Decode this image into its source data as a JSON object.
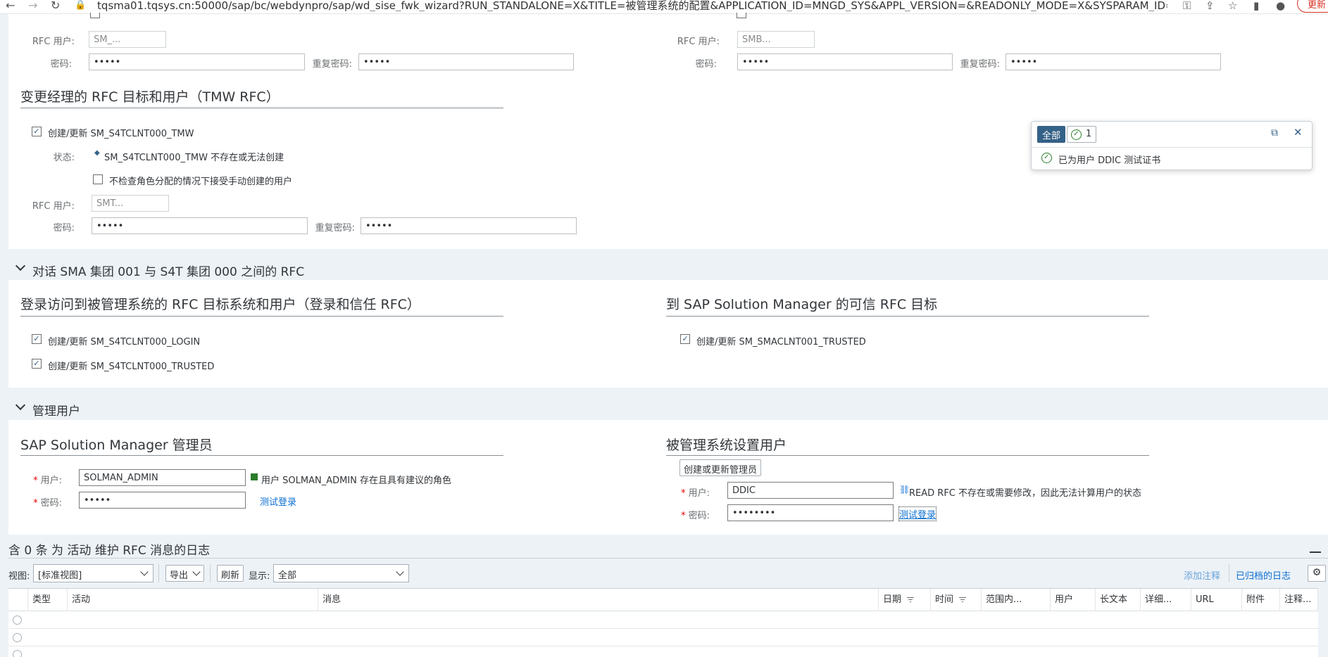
{
  "browser": {
    "url": "tqsma01.tqsys.cn:50000/sap/bc/webdynpro/sap/wd_sise_fwk_wizard?RUN_STANDALONE=X&TITLE=被管理系统的配置&APPLICATION_ID=MNGD_SYS&APPL_VERSION=&READONLY_MODE=X&SYSPARAM_ID=5466B7A52F161B...",
    "update_label": "更新"
  },
  "top_section": {
    "left": {
      "rfc_user_label": "RFC 用户:",
      "rfc_user_value": "SM_...",
      "password_label": "密码:",
      "password_value": "•••••",
      "repeat_password_label": "重复密码:",
      "repeat_password_value": "•••••"
    },
    "right": {
      "rfc_user_label": "RFC 用户:",
      "rfc_user_value": "SMB...",
      "password_label": "密码:",
      "password_value": "•••••",
      "repeat_password_label": "重复密码:",
      "repeat_password_value": "•••••"
    }
  },
  "tmw_section": {
    "title": "变更经理的 RFC 目标和用户（TMW RFC）",
    "create_update_label": "创建/更新 SM_S4TCLNT000_TMW",
    "status_label": "状态:",
    "status_value": "SM_S4TCLNT000_TMW 不存在或无法创建",
    "skip_role_check_label": "不检查角色分配的情况下接受手动创建的用户",
    "rfc_user_label": "RFC 用户:",
    "rfc_user_value": "SMT...",
    "password_label": "密码:",
    "password_value": "•••••",
    "repeat_password_label": "重复密码:",
    "repeat_password_value": "•••••"
  },
  "dialog_rfc_group": {
    "header": "对话 SMA 集团 001 与 S4T 集团 000 之间的 RFC",
    "left_title": "登录访问到被管理系统的 RFC 目标系统和用户（登录和信任 RFC）",
    "login_label": "创建/更新 SM_S4TCLNT000_LOGIN",
    "trusted_label": "创建/更新 SM_S4TCLNT000_TRUSTED",
    "right_title": "到 SAP Solution Manager 的可信 RFC 目标",
    "sma_trusted_label": "创建/更新 SM_SMACLNT001_TRUSTED"
  },
  "admin_group": {
    "header": "管理用户",
    "left_title": "SAP Solution Manager 管理员",
    "user_label": "用户:",
    "user_value": "SOLMAN_ADMIN",
    "user_status": "用户 SOLMAN_ADMIN 存在且具有建议的角色",
    "password_label": "密码:",
    "password_value": "•••••",
    "test_login_label": "测试登录",
    "right_title": "被管理系统设置用户",
    "create_admin_button": "创建或更新管理员",
    "ms_user_label": "用户:",
    "ms_user_value": "DDIC",
    "ms_user_status": "READ RFC 不存在或需要修改，因此无法计算用户的状态",
    "ms_password_label": "密码:",
    "ms_password_value": "••••••••",
    "ms_test_login_label": "测试登录"
  },
  "popover": {
    "all_label": "全部",
    "ok_count": "1",
    "message": "已为用户 DDIC 测试证书"
  },
  "log": {
    "title": "含 0 条 为 活动 维护 RFC 消息的日志",
    "view_label": "视图:",
    "view_value": "[标准视图]",
    "export_label": "导出",
    "refresh_label": "刷新",
    "display_label": "显示:",
    "display_value": "全部",
    "add_note_label": "添加注释",
    "archived_log_label": "已归档的日志",
    "columns": [
      "类型",
      "活动",
      "消息",
      "日期",
      "时间",
      "范围内...",
      "用户",
      "长文本",
      "详细...",
      "URL",
      "附件",
      "注释..."
    ]
  },
  "colors": {
    "accent": "#346187",
    "link": "#0a6ed1",
    "success": "#2b7d2b",
    "band": "#edf2f7"
  }
}
